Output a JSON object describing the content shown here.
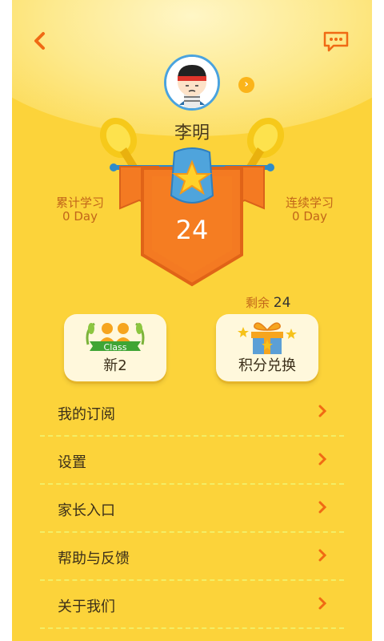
{
  "user": {
    "name": "李明"
  },
  "stats": {
    "cumulative_label": "累计学习",
    "cumulative_value": "0 Day",
    "streak_label": "连续学习",
    "streak_value": "0 Day",
    "score": "24",
    "remain_label": "剩余",
    "remain_value": "24"
  },
  "tiles": {
    "class_banner": "Class",
    "class_label": "新2",
    "gift_label": "积分兑换"
  },
  "menu": [
    {
      "label": "我的订阅"
    },
    {
      "label": "设置"
    },
    {
      "label": "家长入口"
    },
    {
      "label": "帮助与反馈"
    },
    {
      "label": "关于我们"
    }
  ],
  "icons": {
    "back": "back-arrow-icon",
    "message": "message-icon",
    "profile_arrow": "chevron-right-icon"
  },
  "colors": {
    "background": "#fcd33a",
    "accent_orange": "#f57c20",
    "text_brown": "#c2661a"
  }
}
